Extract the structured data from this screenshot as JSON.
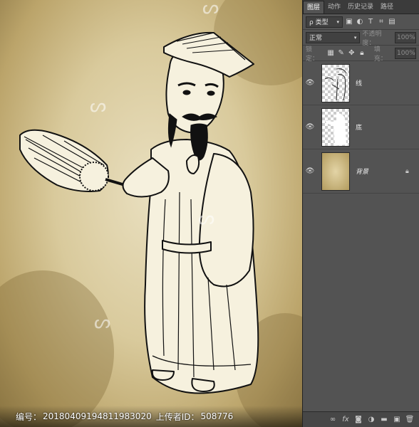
{
  "watermark": {
    "label": "编号：",
    "id_number": "20180409194811983020",
    "uploader_label": "上传者ID：",
    "uploader_id": "508776"
  },
  "panel": {
    "tabs": [
      "图层",
      "动作",
      "历史记录",
      "路径"
    ],
    "active_tab": "图层",
    "filter": {
      "icon": "search-icon",
      "value": "ρ 类型"
    },
    "blend_mode": "正常",
    "opacity_label": "不透明度：",
    "opacity_value": "100%",
    "lock_label": "锁定：",
    "fill_label": "填充：",
    "fill_value": "100%",
    "layers": [
      {
        "name": "线",
        "visible": true,
        "locked": false,
        "type": "lineart"
      },
      {
        "name": "底",
        "visible": true,
        "locked": false,
        "type": "fill"
      },
      {
        "name": "背景",
        "visible": true,
        "locked": true,
        "type": "background"
      }
    ]
  },
  "colors": {
    "panel_bg": "#535353",
    "parchment": "#d9ca9c",
    "ink": "#111111"
  }
}
